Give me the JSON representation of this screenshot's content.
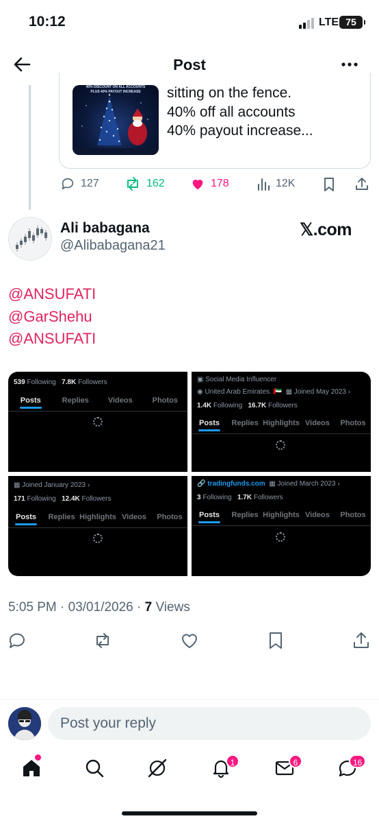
{
  "status_bar": {
    "time": "10:12",
    "network": "LTE",
    "battery": "75"
  },
  "header": {
    "title": "Post"
  },
  "quoted_post": {
    "image_text": {
      "line1": "40% DISCOUNT ON ALL ACCOUNTS",
      "line2": "PLUS 40% PAYOUT INCREASE"
    },
    "lines": [
      "sitting on the fence.",
      "40% off all accounts",
      "40% payout increase..."
    ],
    "actions": {
      "replies": "127",
      "reposts": "162",
      "likes": "178",
      "views": "12K"
    }
  },
  "post": {
    "author_name": "Ali babagana",
    "author_handle": "@Alibabagana21",
    "source": "𝕏.com",
    "mentions": [
      "@ANSUFATI",
      "@GarShehu",
      "@ANSUFATI"
    ],
    "timestamp": "5:05 PM · 03/01/2026 · ",
    "views_count": "7",
    "views_label": " Views"
  },
  "screenshots": [
    {
      "following": "539",
      "following_label": "Following",
      "followers": "7.8K",
      "followers_label": "Followers",
      "tabs": [
        "Posts",
        "Replies",
        "Videos",
        "Photos"
      ]
    },
    {
      "category": "Social Media Influencer",
      "location": "United Arab Emirates. 🇦🇪",
      "joined": "Joined May 2023",
      "following": "1.4K",
      "following_label": "Following",
      "followers": "16.7K",
      "followers_label": "Followers",
      "tabs": [
        "Posts",
        "Replies",
        "Highlights",
        "Videos",
        "Photos"
      ]
    },
    {
      "joined": "Joined January 2023",
      "following": "171",
      "following_label": "Following",
      "followers": "12.4K",
      "followers_label": "Followers",
      "tabs": [
        "Posts",
        "Replies",
        "Highlights",
        "Videos",
        "Photos"
      ]
    },
    {
      "website": "tradingfunds.com",
      "joined": "Joined March 2023",
      "following": "3",
      "following_label": "Following",
      "followers": "1.7K",
      "followers_label": "Followers",
      "tabs": [
        "Posts",
        "Replies",
        "Highlights",
        "Videos",
        "Photos"
      ]
    }
  ],
  "reply": {
    "placeholder": "Post your reply"
  },
  "nav": {
    "notifications_badge": "1",
    "messages_badge": "6",
    "communities_badge": "16"
  },
  "colors": {
    "accent": "#1d9bf0",
    "like": "#f91880",
    "repost": "#00ba7c",
    "mention": "#e0245e",
    "text_secondary": "#536471"
  }
}
